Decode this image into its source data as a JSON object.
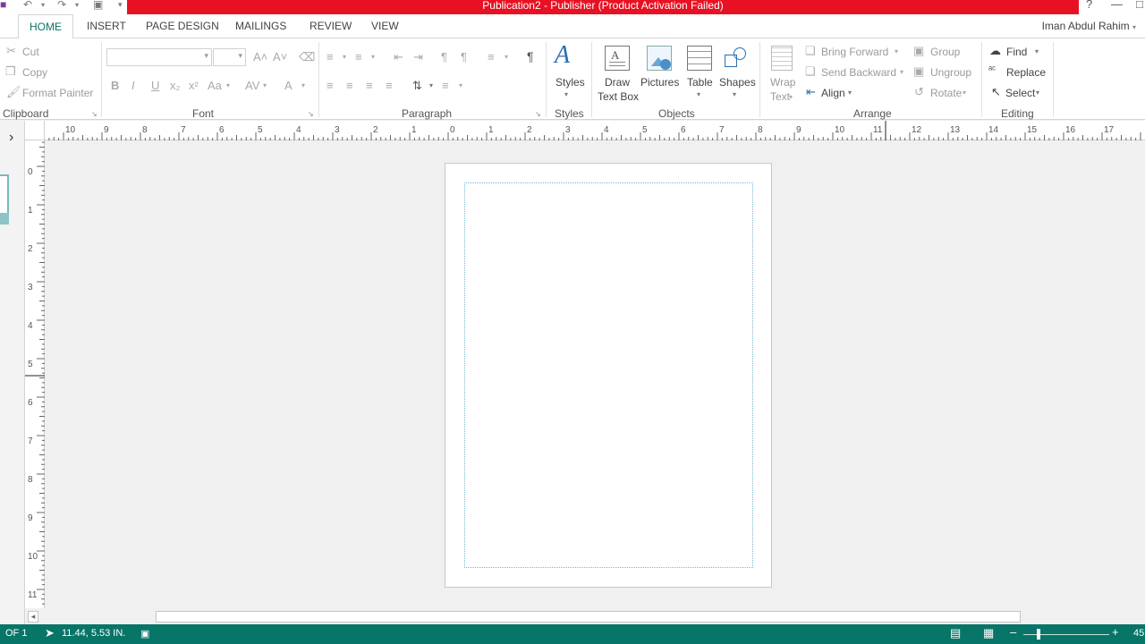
{
  "window": {
    "title": "Publication2 -  Publisher (Product Activation Failed)",
    "help_glyph": "?",
    "minimize_glyph": "—"
  },
  "qat": {
    "undo_glyph": "↶",
    "redo_glyph": "↷",
    "customize_glyph": "▾"
  },
  "tabs": [
    "HOME",
    "INSERT",
    "PAGE DESIGN",
    "MAILINGS",
    "REVIEW",
    "VIEW"
  ],
  "user": {
    "name": "Iman Abdul Rahim"
  },
  "ribbon": {
    "clipboard": {
      "cut": "Cut",
      "copy": "Copy",
      "format_painter": "Format Painter",
      "label": "Clipboard"
    },
    "font": {
      "label": "Font",
      "font_name": "",
      "font_size": "",
      "grow_glyph": "A˄",
      "shrink_glyph": "A˅",
      "bold": "B",
      "italic": "I",
      "underline": "U",
      "subscript": "x₂",
      "superscript": "x²",
      "change_case": "Aa",
      "char_spacing": "AV",
      "font_color": "A"
    },
    "paragraph": {
      "label": "Paragraph",
      "pilcrow": "¶"
    },
    "styles": {
      "label": "Styles",
      "button": "Styles"
    },
    "objects": {
      "label": "Objects",
      "draw_text_box_line1": "Draw",
      "draw_text_box_line2": "Text Box",
      "pictures": "Pictures",
      "table": "Table",
      "shapes": "Shapes"
    },
    "arrange": {
      "label": "Arrange",
      "wrap_text_line1": "Wrap",
      "wrap_text_line2": "Text",
      "bring_forward": "Bring Forward",
      "send_backward": "Send Backward",
      "align": "Align",
      "group": "Group",
      "ungroup": "Ungroup",
      "rotate": "Rotate"
    },
    "editing": {
      "label": "Editing",
      "find": "Find",
      "replace": "Replace",
      "select": "Select"
    }
  },
  "rulers": {
    "horizontal_labels": [
      "10",
      "9",
      "8",
      "7",
      "6",
      "5",
      "4",
      "3",
      "2",
      "1",
      "0",
      "1",
      "2",
      "3",
      "4",
      "5",
      "6",
      "7",
      "8",
      "9",
      "10",
      "11",
      "12",
      "13",
      "14",
      "15",
      "16",
      "17"
    ],
    "vertical_labels": [
      "0",
      "1",
      "2",
      "3",
      "4",
      "5",
      "6",
      "7",
      "8",
      "9",
      "10",
      "11"
    ]
  },
  "status": {
    "page": "OF 1",
    "position": "11.44, 5.53 IN.",
    "zoom": "45"
  },
  "panel_toggle_glyph": "›"
}
